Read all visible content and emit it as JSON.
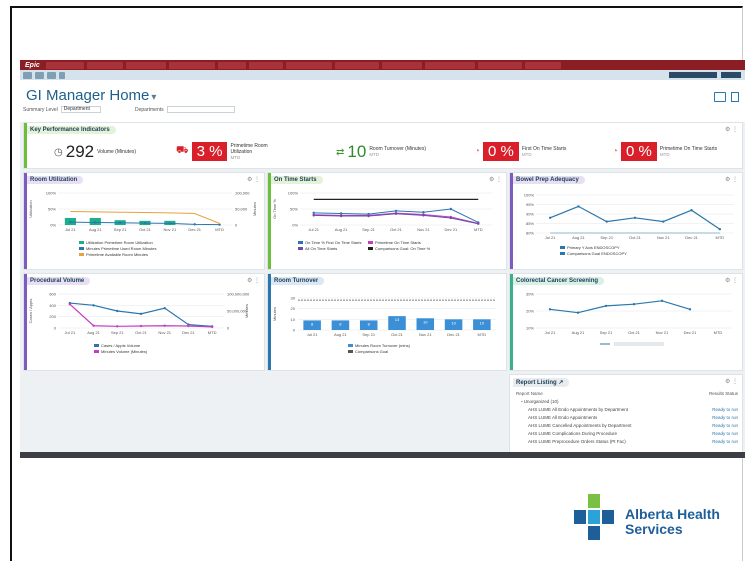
{
  "app": {
    "title": "GI Manager Home",
    "brand_logo": "Epic",
    "accent_color": "#8b1d24",
    "support_label": "AHS SUPPORT NORTH",
    "support_short": "CONNECT"
  },
  "filters": {
    "summary_level_label": "Summary Level",
    "summary_level_value": "Department",
    "departments_label": "Departments"
  },
  "kpis": {
    "title": "Key Performance Indicators",
    "items": [
      {
        "value": "292",
        "label": "Volume (Minutes)",
        "sub": "",
        "style": "plain",
        "icon": "clock-icon"
      },
      {
        "value": "3 %",
        "label": "Primetime Room Utilization",
        "sub": "MTD",
        "style": "red",
        "icon": "bed-icon"
      },
      {
        "value": "10",
        "label": "Room Turnover (Minutes)",
        "sub": "MTD",
        "style": "green",
        "icon": "turnover-icon"
      },
      {
        "value": "0 %",
        "label": "First On Time Starts",
        "sub": "MTD",
        "style": "red",
        "icon": "gauge-icon"
      },
      {
        "value": "0 %",
        "label": "Primetime On Time Starts",
        "sub": "MTD",
        "style": "red",
        "icon": "gauge-icon"
      }
    ]
  },
  "panels": {
    "room_utilization": {
      "title": "Room Utilization",
      "legend": [
        "Utilization",
        "Primetime Room Utilization",
        "Minutes",
        "Primetime Used Room Minutes",
        "Primetime Available Room Minutes"
      ],
      "accent": "#7d5bbf"
    },
    "on_time_starts": {
      "title": "On Time Starts",
      "legend": [
        "On Time %",
        "First On Time Starts",
        "Primetime On Time Starts",
        "All On Time Starts",
        "Comparisons",
        "Goal: On Time %"
      ],
      "accent": "#6bbf3a"
    },
    "bowel_prep": {
      "title": "Bowel Prep Adequacy",
      "legend": [
        "Primary Y Axis",
        "ENDOSCOPY",
        "Comparisons",
        "Goal",
        "ENDOSCOPY"
      ],
      "accent": "#7d5bbf"
    },
    "procedural_volume": {
      "title": "Procedural Volume",
      "legend": [
        "Cases / Appts",
        "Volume",
        "Minutes",
        "Volume (Minutes)"
      ],
      "accent": "#7d5bbf"
    },
    "room_turnover": {
      "title": "Room Turnover",
      "legend": [
        "Minutes",
        "Room Turnover (mins)",
        "Comparisons",
        "Goal"
      ],
      "accent": "#2b76ad"
    },
    "colorectal": {
      "title": "Colorectal Cancer Screening",
      "accent": "#3aaf8a"
    },
    "report_listing": {
      "title": "Report Listing",
      "col_name": "Report Name",
      "col_results": "Results",
      "col_status": "Status",
      "group": "Unorganized (10)",
      "rows": [
        {
          "name": "AHS LUME All Endo Appointments by Department",
          "status": "Ready to run"
        },
        {
          "name": "AHS LUME All Endo Appointments",
          "status": "Ready to run"
        },
        {
          "name": "AHS LUME Cancelled Appointments by Department",
          "status": "Ready to run"
        },
        {
          "name": "AHS LUME Complications During Procedure",
          "status": "Ready to run"
        },
        {
          "name": "AHS LUME Preprocedure Orders Status (Pt Fac)",
          "status": "Ready to run"
        }
      ]
    }
  },
  "footer": {
    "org_name_line1": "Alberta Health",
    "org_name_line2": "Services"
  },
  "chart_data": [
    {
      "id": "room_utilization",
      "type": "line",
      "categories": [
        "Jul 21",
        "Aug 21",
        "Sep 21",
        "Oct 21",
        "Nov 21",
        "Dec 21",
        "MTD"
      ],
      "series": [
        {
          "name": "Primetime Room Utilization",
          "type": "bar",
          "values": [
            22,
            22,
            15,
            13,
            13,
            null,
            null
          ]
        },
        {
          "name": "Primetime Used Room Minutes",
          "type": "line",
          "values": [
            9000,
            8000,
            7000,
            6000,
            5000,
            2000,
            1000
          ]
        },
        {
          "name": "Primetime Available Room Minutes",
          "type": "line",
          "values": [
            42000,
            41000,
            40000,
            39000,
            38000,
            36000,
            5000
          ]
        }
      ],
      "ylim": [
        0,
        100
      ],
      "y2lim": [
        0,
        100000
      ],
      "yticks": [
        "100%",
        "50%",
        "0%"
      ],
      "y2ticks": [
        "100,000",
        "50,000",
        "0"
      ],
      "ylabel": "Utilization",
      "y2label": "Minutes"
    },
    {
      "id": "on_time_starts",
      "type": "line",
      "categories": [
        "Jul 21",
        "Aug 21",
        "Sep 21",
        "Oct 21",
        "Nov 21",
        "Dec 21",
        "MTD"
      ],
      "series": [
        {
          "name": "First On Time Starts",
          "values": [
            38,
            36,
            34,
            44,
            40,
            50,
            8
          ]
        },
        {
          "name": "Primetime On Time Starts",
          "values": [
            32,
            30,
            30,
            37,
            33,
            25,
            5
          ]
        },
        {
          "name": "All On Time Starts",
          "values": [
            30,
            28,
            28,
            35,
            30,
            22,
            4
          ]
        },
        {
          "name": "Goal: On Time %",
          "values": [
            80,
            80,
            80,
            80,
            80,
            80,
            80
          ]
        }
      ],
      "ylim": [
        0,
        100
      ],
      "yticks": [
        "100%",
        "50%",
        "0%"
      ],
      "ylabel": "On Time %"
    },
    {
      "id": "bowel_prep",
      "type": "line",
      "categories": [
        "Jul 21",
        "Aug 21",
        "Sep 21",
        "Oct 21",
        "Nov 21",
        "Dec 21",
        "MTD"
      ],
      "series": [
        {
          "name": "ENDOSCOPY",
          "values": [
            88,
            94,
            86,
            88,
            86,
            92,
            82
          ]
        },
        {
          "name": "Goal",
          "values": [
            80,
            80,
            80,
            80,
            80,
            80,
            80
          ]
        }
      ],
      "ylim": [
        80,
        100
      ],
      "yticks": [
        "100%",
        "95%",
        "90%",
        "85%",
        "80%"
      ]
    },
    {
      "id": "procedural_volume",
      "type": "line",
      "categories": [
        "Jul 21",
        "Aug 21",
        "Sep 21",
        "Oct 21",
        "Nov 21",
        "Dec 21",
        "MTD"
      ],
      "series": [
        {
          "name": "Volume",
          "values": [
            440,
            400,
            300,
            250,
            350,
            60,
            30
          ]
        },
        {
          "name": "Volume (Minutes)",
          "values": [
            420,
            40,
            30,
            35,
            40,
            35,
            20
          ]
        }
      ],
      "ylim": [
        0,
        600
      ],
      "y2lim": [
        0,
        100000000
      ],
      "yticks": [
        "600",
        "400",
        "200",
        "0"
      ],
      "y2ticks": [
        "100,000,000",
        "50,000,000",
        "0"
      ],
      "ylabel": "Cases / Appts",
      "y2label": "Minutes"
    },
    {
      "id": "room_turnover",
      "type": "bar",
      "categories": [
        "Jul 21",
        "Aug 21",
        "Sep 21",
        "Oct 21",
        "Nov 21",
        "Dec 21",
        "MTD"
      ],
      "values": [
        9,
        9,
        9,
        13,
        11,
        10,
        10
      ],
      "labels": [
        "8",
        "8",
        "8",
        "13",
        "10",
        "10",
        "10"
      ],
      "ylim": [
        0,
        30
      ],
      "yticks": [
        "30",
        "20",
        "10",
        "0"
      ],
      "ylabel": "Minutes"
    },
    {
      "id": "colorectal",
      "type": "line",
      "categories": [
        "Jul 21",
        "Aug 21",
        "Sep 21",
        "Oct 21",
        "Nov 21",
        "Dec 21",
        "MTD"
      ],
      "series": [
        {
          "name": "Series",
          "values": [
            21,
            19,
            23,
            24,
            26,
            21,
            null
          ]
        }
      ],
      "ylim": [
        10,
        30
      ],
      "yticks": [
        "30%",
        "20%",
        "10%"
      ]
    }
  ]
}
